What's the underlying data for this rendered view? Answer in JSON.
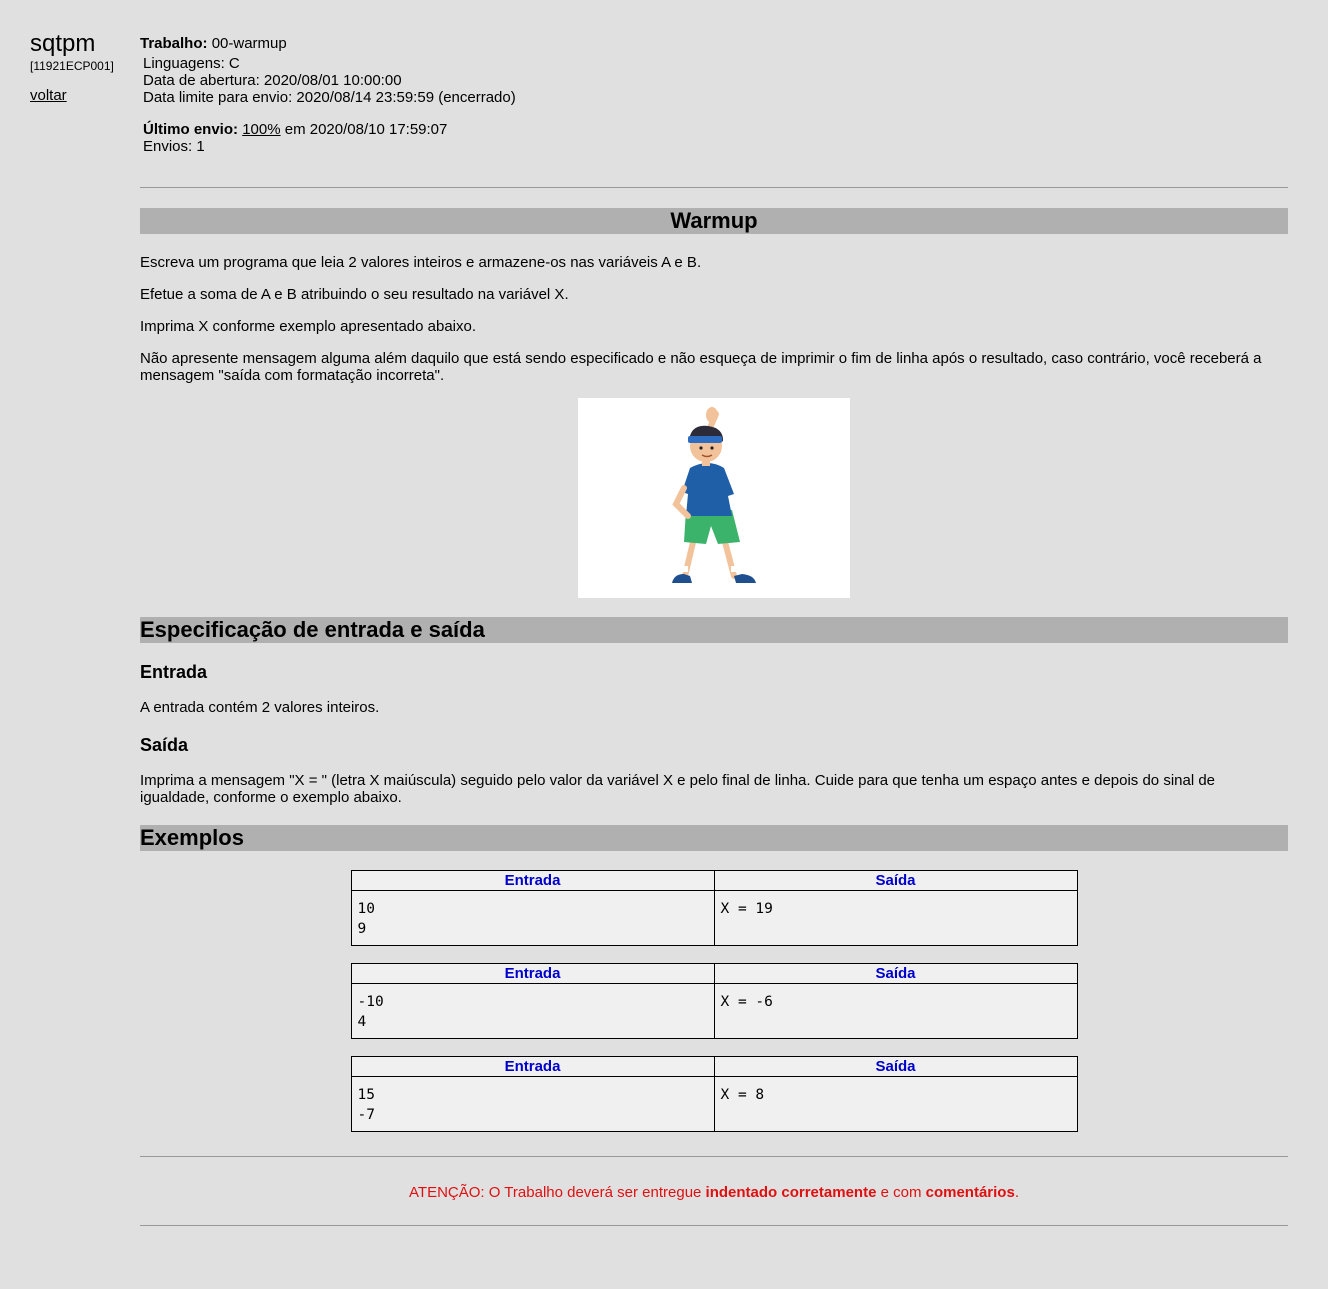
{
  "sidebar": {
    "app_name": "sqtpm",
    "course_code": "[11921ECP001]",
    "back_label": "voltar"
  },
  "assignment": {
    "work_label": "Trabalho:",
    "work_value": "00-warmup",
    "languages": "Linguagens: C",
    "open_date": "Data de abertura: 2020/08/01 10:00:00",
    "deadline": "Data limite para envio: 2020/08/14 23:59:59 (encerrado)",
    "last_submission_label": "Último envio:",
    "last_submission_score": "100%",
    "last_submission_date": "em 2020/08/10 17:59:07",
    "submissions": "Envios: 1"
  },
  "problem": {
    "title": "Warmup",
    "paragraphs": [
      "Escreva um programa que leia 2 valores inteiros e armazene-os nas variáveis A e B.",
      "Efetue a soma de A e B atribuindo o seu resultado na variável X.",
      "Imprima X conforme exemplo apresentado abaixo.",
      "Não apresente mensagem alguma além daquilo que está sendo especificado e não esqueça de imprimir o fim de linha após o resultado, caso contrário, você receberá a mensagem \"saída com formatação incorreta\"."
    ],
    "spec_heading": "Especificação de entrada e saída",
    "input_heading": "Entrada",
    "input_text": "A entrada contém 2 valores inteiros.",
    "output_heading": "Saída",
    "output_text": "Imprima a mensagem \"X = \" (letra X maiúscula) seguido pelo valor da variável X e pelo final de linha. Cuide para que tenha um espaço antes e depois do sinal de igualdade, conforme o exemplo abaixo.",
    "examples_heading": "Exemplos"
  },
  "examples": {
    "input_header": "Entrada",
    "output_header": "Saída",
    "cases": [
      {
        "input": "10\n9",
        "output": "X = 19"
      },
      {
        "input": "-10\n4",
        "output": "X = -6"
      },
      {
        "input": "15\n-7",
        "output": "X = 8"
      }
    ]
  },
  "notice": {
    "prefix": "ATENÇÃO: O Trabalho deverá ser entregue ",
    "bold1": "indentado corretamente",
    "middle": " e com ",
    "bold2": "comentários",
    "suffix": "."
  },
  "colors": {
    "page_bg": "#e0e0e0",
    "band_bg": "#b0b0b0",
    "table_header_text": "#0000cc",
    "notice_text": "#e01010"
  },
  "illustration_icon": "person-stretching-illustration"
}
